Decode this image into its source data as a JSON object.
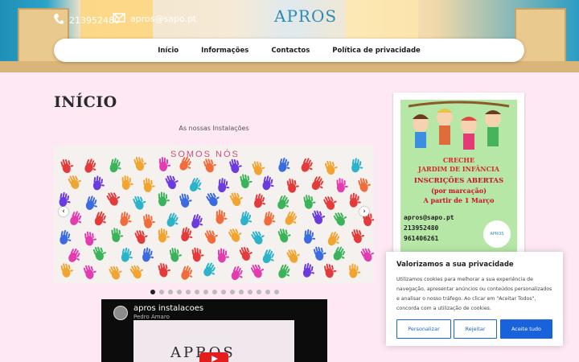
{
  "header": {
    "logo": "APROS",
    "phone": "213952480",
    "email": "apros@sapo.pt"
  },
  "nav": {
    "items": [
      "Início",
      "Informações",
      "Contactos",
      "Política de privacidade"
    ]
  },
  "page": {
    "title": "INÍCIO",
    "subtitle": "As nossas Instalações"
  },
  "slider": {
    "banner_text": "SOMOS NÓS",
    "prev_label": "‹",
    "next_label": "›",
    "dot_count": 15,
    "active_dot": 0
  },
  "video": {
    "title": "apros instalacoes",
    "author": "Pedro Amaro",
    "brand": "APROS"
  },
  "poster": {
    "line1": "CRECHE",
    "line2": "JARDIM DE INFÂNCIA",
    "line3": "INSCRIÇÕES ABERTAS",
    "line4": "(por marcação)",
    "line5": "A partir de 1 Março",
    "email": "apros@sapo.pt",
    "phone1": "213952480",
    "phone2": "961406261",
    "logo": "APROS"
  },
  "cookie": {
    "title": "Valorizamos a sua privacidade",
    "body": "Utilizamos cookies para melhorar a sua experiência de navegação, apresentar anúncios ou conteúdos personalizados e analisar o nosso tráfego. Ao clicar em \"Aceitar Todos\", concorda com a utilização de cookies.",
    "customize": "Personalizar",
    "reject": "Rejeitar",
    "accept": "Aceite tudo"
  },
  "colors": {
    "background": "#fde8f3",
    "accent_blue": "#1863dc",
    "logo_color": "#2a8bb3"
  }
}
